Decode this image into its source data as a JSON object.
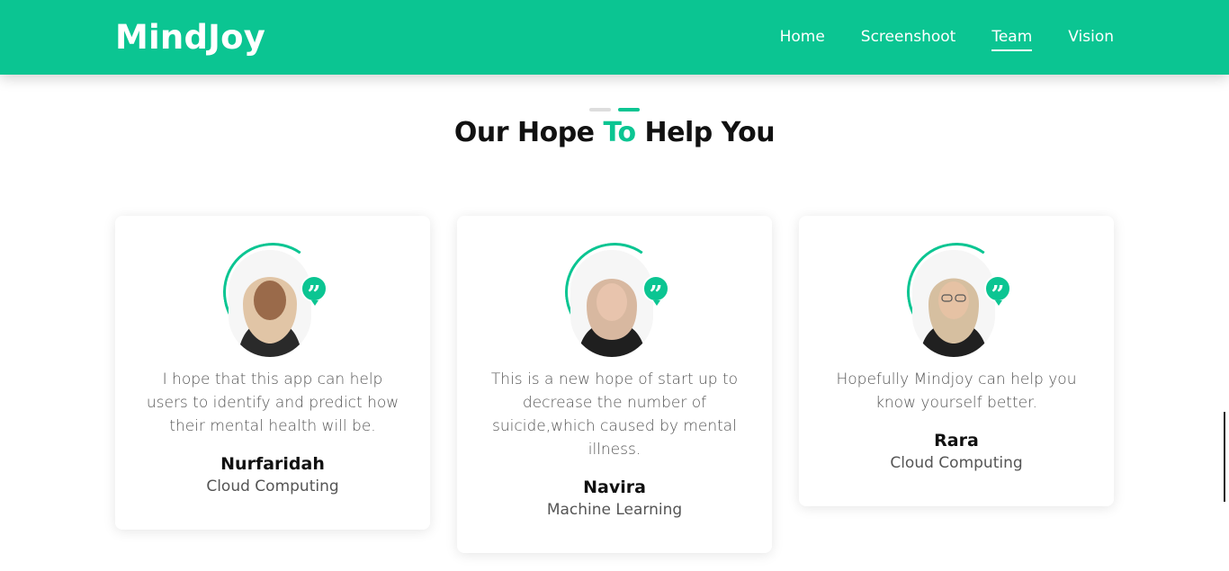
{
  "brand": "MindJoy",
  "nav": [
    {
      "label": "Home"
    },
    {
      "label": "Screenshoot"
    },
    {
      "label": "Team"
    },
    {
      "label": "Vision"
    }
  ],
  "nav_active": "Team",
  "section": {
    "title_part1": "Our Hope ",
    "title_accent": "To",
    "title_part2": " Help You"
  },
  "cards": [
    {
      "quote": "I hope that this app can help users to identify and predict how their mental health will be.",
      "name": "Nurfaridah",
      "role": "Cloud Computing"
    },
    {
      "quote": "This is a new hope of start up to decrease the number of suicide,which caused by mental illness.",
      "name": "Navira",
      "role": "Machine Learning"
    },
    {
      "quote": "Hopefully Mindjoy can help you know yourself better.",
      "name": "Rara",
      "role": "Cloud Computing"
    }
  ],
  "quote_icon": "quote-icon",
  "colors": {
    "accent": "#0bc592",
    "text": "#111111",
    "muted": "#555555"
  }
}
